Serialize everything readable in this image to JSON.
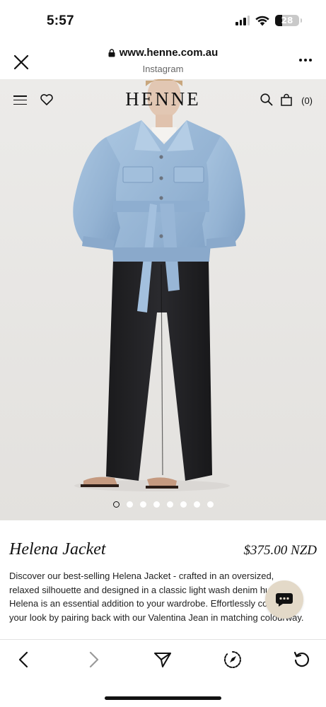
{
  "status_bar": {
    "time": "5:57",
    "battery": "28",
    "battery_level": 0.28,
    "signal_bars": 3,
    "icons": [
      "signal-icon",
      "wifi-icon",
      "battery-icon"
    ]
  },
  "browser": {
    "url": "www.henne.com.au",
    "source": "Instagram",
    "icons": [
      "close-icon",
      "lock-icon",
      "more-icon"
    ]
  },
  "site": {
    "logo": "HENNE",
    "cart_count": "(0)",
    "icons": [
      "menu-icon",
      "heart-icon",
      "search-icon",
      "bag-icon"
    ]
  },
  "gallery": {
    "total_images": 8,
    "active_index": 0
  },
  "product": {
    "title": "Helena Jacket",
    "price": "$375.00 NZD",
    "description": "Discover our best-selling Helena Jacket - crafted in an oversized, relaxed silhouette and designed in a classic light wash denim hue, Helena is an essential addition to your wardrobe. Effortlessly complete your look by pairing back with our Valentina Jean in matching colourway."
  },
  "chat": {
    "icon": "chat-icon"
  },
  "toolbar": {
    "icons": [
      "back-icon",
      "forward-icon",
      "share-icon",
      "safari-icon",
      "reload-icon"
    ]
  },
  "colors": {
    "hero_background": "#e9e7e5",
    "denim": "#9cbad8",
    "trousers": "#1d1d20",
    "chat_bubble": "#e3d9c8"
  }
}
